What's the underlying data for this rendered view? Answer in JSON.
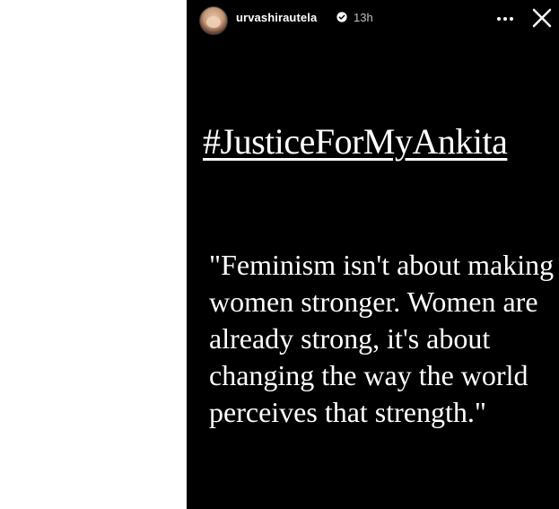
{
  "story": {
    "username": "urvashirautela",
    "verified_icon": "verified-badge-icon",
    "timestamp": "13h",
    "more_icon": "more-options-icon",
    "close_icon": "close-icon",
    "hashtag": "#JusticeForMyAnkita",
    "quote": "\"Feminism isn't about making women stronger. Women are already strong, it's about changing the way the world perceives that strength.\""
  },
  "colors": {
    "page_background": "#ffffff",
    "story_background": "#000000",
    "text": "#ffffff",
    "timestamp": "#bfbfbf"
  }
}
